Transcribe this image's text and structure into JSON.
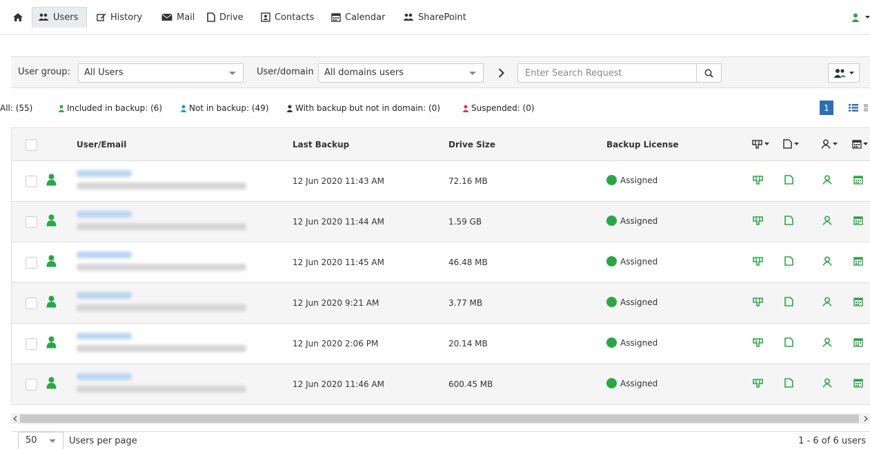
{
  "nav": {
    "items": [
      {
        "label": "Users",
        "icon": "users-icon"
      },
      {
        "label": "History",
        "icon": "edit-icon"
      },
      {
        "label": "Mail",
        "icon": "envelope-icon"
      },
      {
        "label": "Drive",
        "icon": "file-icon"
      },
      {
        "label": "Contacts",
        "icon": "contact-card-icon"
      },
      {
        "label": "Calendar",
        "icon": "calendar-icon"
      },
      {
        "label": "SharePoint",
        "icon": "users-icon"
      }
    ]
  },
  "filters": {
    "user_group_label": "User group:",
    "user_group_value": "All Users",
    "user_domain_label": "User/domain",
    "user_domain_value": "All domains users",
    "search_placeholder": "Enter Search Request"
  },
  "status": {
    "all": "All: (55)",
    "included": "Included in backup: (6)",
    "not_in": "Not in backup: (49)",
    "with_backup": "With backup but not in domain: (0)",
    "suspended": "Suspended: (0)",
    "page": "1"
  },
  "table": {
    "headers": {
      "user": "User/Email",
      "last_backup": "Last Backup",
      "drive_size": "Drive Size",
      "license": "Backup License"
    },
    "rows": [
      {
        "last_backup": "12 Jun 2020 11:43 AM",
        "drive_size": "72.16 MB",
        "license": "Assigned"
      },
      {
        "last_backup": "12 Jun 2020 11:44 AM",
        "drive_size": "1.59 GB",
        "license": "Assigned"
      },
      {
        "last_backup": "12 Jun 2020 11:45 AM",
        "drive_size": "46.48 MB",
        "license": "Assigned"
      },
      {
        "last_backup": "12 Jun 2020 9:21 AM",
        "drive_size": "3.77 MB",
        "license": "Assigned"
      },
      {
        "last_backup": "12 Jun 2020 2:06 PM",
        "drive_size": "20.14 MB",
        "license": "Assigned"
      },
      {
        "last_backup": "12 Jun 2020 11:46 AM",
        "drive_size": "600.45 MB",
        "license": "Assigned"
      }
    ]
  },
  "pager": {
    "per_page": "50",
    "per_page_label": "Users per page",
    "range": "1 - 6 of 6 users"
  },
  "colors": {
    "green": "#28a745",
    "teal": "#17a2b8",
    "red": "#dc3545",
    "dark": "#333333",
    "page_badge": "#2d6eb4"
  }
}
